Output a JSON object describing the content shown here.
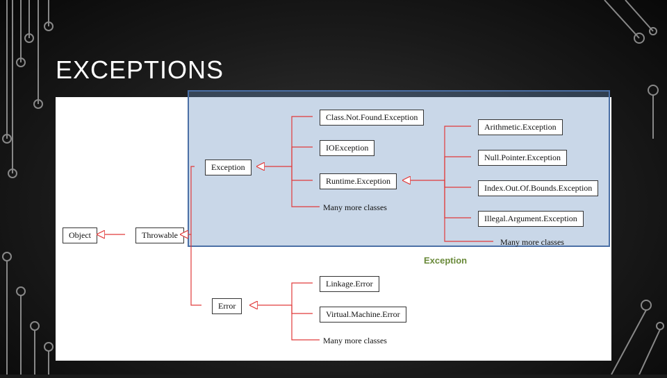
{
  "title": "EXCEPTIONS",
  "diagram": {
    "root": "Object",
    "throwable": "Throwable",
    "exception": "Exception",
    "error": "Error",
    "exc_children": {
      "class_not_found": "Class.Not.Found.Exception",
      "io": "IOException",
      "runtime": "Runtime.Exception",
      "more": "Many more classes"
    },
    "runtime_children": {
      "arithmetic": "Arithmetic.Exception",
      "null_pointer": "Null.Pointer.Exception",
      "index_oob": "Index.Out.Of.Bounds.Exception",
      "illegal_arg": "Illegal.Argument.Exception",
      "more": "Many more classes"
    },
    "error_children": {
      "linkage": "Linkage.Error",
      "vm": "Virtual.Machine.Error",
      "more": "Many more classes"
    }
  },
  "highlight_label": "Exception",
  "colors": {
    "connector": "#e13a3a",
    "highlight_fill": "rgba(100,140,190,0.35)",
    "highlight_border": "#4a6fa5",
    "caption": "#6a8a3a"
  }
}
